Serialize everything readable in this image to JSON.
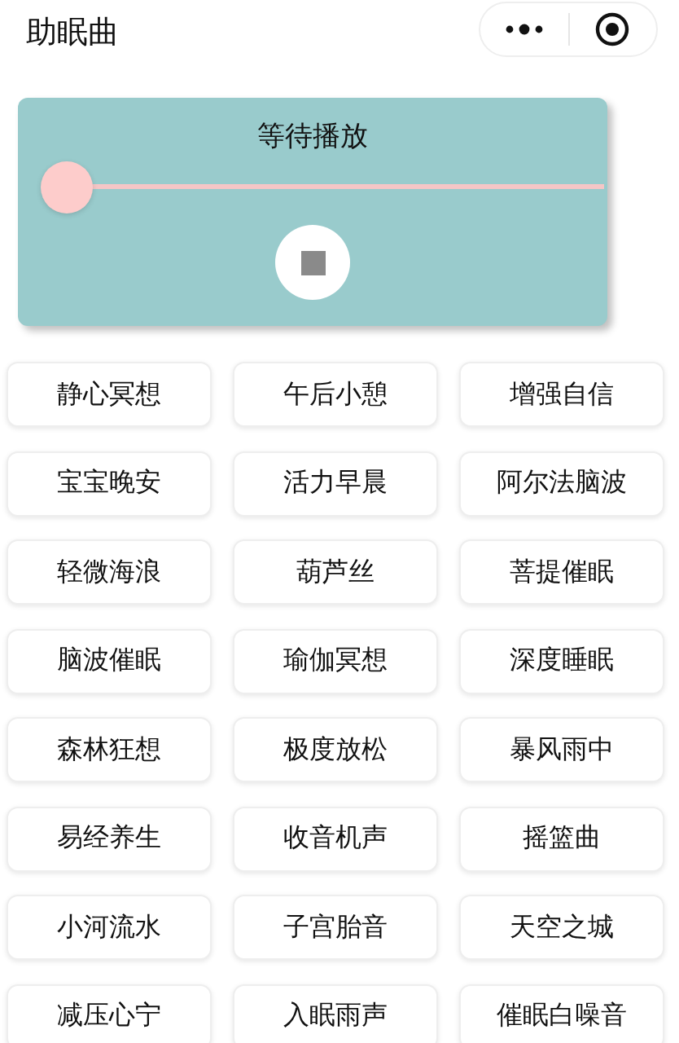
{
  "header": {
    "title": "助眠曲"
  },
  "player": {
    "status": "等待播放",
    "level": 0
  },
  "tracks": [
    {
      "label": "静心冥想"
    },
    {
      "label": "午后小憩"
    },
    {
      "label": "增强自信"
    },
    {
      "label": "宝宝晚安"
    },
    {
      "label": "活力早晨"
    },
    {
      "label": "阿尔法脑波"
    },
    {
      "label": "轻微海浪"
    },
    {
      "label": "葫芦丝"
    },
    {
      "label": "菩提催眠"
    },
    {
      "label": "脑波催眠"
    },
    {
      "label": "瑜伽冥想"
    },
    {
      "label": "深度睡眠"
    },
    {
      "label": "森林狂想"
    },
    {
      "label": "极度放松"
    },
    {
      "label": "暴风雨中"
    },
    {
      "label": "易经养生"
    },
    {
      "label": "收音机声"
    },
    {
      "label": "摇篮曲"
    },
    {
      "label": "小河流水"
    },
    {
      "label": "子宫胎音"
    },
    {
      "label": "天空之城"
    },
    {
      "label": "减压心宁"
    },
    {
      "label": "入眠雨声"
    },
    {
      "label": "催眠白噪音"
    }
  ]
}
